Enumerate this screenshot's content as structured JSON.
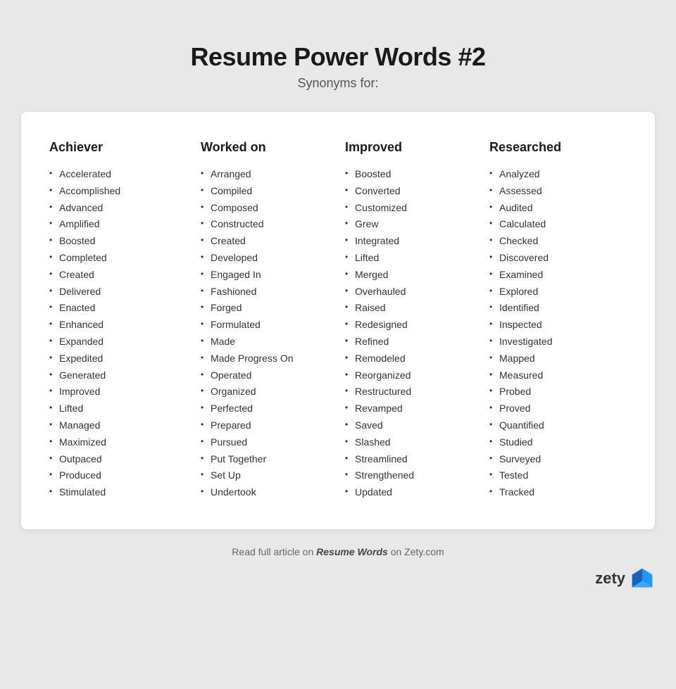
{
  "header": {
    "title": "Resume Power Words #2",
    "subtitle": "Synonyms for:"
  },
  "columns": [
    {
      "header": "Achiever",
      "words": [
        "Accelerated",
        "Accomplished",
        "Advanced",
        "Amplified",
        "Boosted",
        "Completed",
        "Created",
        "Delivered",
        "Enacted",
        "Enhanced",
        "Expanded",
        "Expedited",
        "Generated",
        "Improved",
        "Lifted",
        "Managed",
        "Maximized",
        "Outpaced",
        "Produced",
        "Stimulated"
      ]
    },
    {
      "header": "Worked on",
      "words": [
        "Arranged",
        "Compiled",
        "Composed",
        "Constructed",
        "Created",
        "Developed",
        "Engaged In",
        "Fashioned",
        "Forged",
        "Formulated",
        "Made",
        "Made Progress On",
        "Operated",
        "Organized",
        "Perfected",
        "Prepared",
        "Pursued",
        "Put Together",
        "Set Up",
        "Undertook"
      ]
    },
    {
      "header": "Improved",
      "words": [
        "Boosted",
        "Converted",
        "Customized",
        "Grew",
        "Integrated",
        "Lifted",
        "Merged",
        "Overhauled",
        "Raised",
        "Redesigned",
        "Refined",
        "Remodeled",
        "Reorganized",
        "Restructured",
        "Revamped",
        "Saved",
        "Slashed",
        "Streamlined",
        "Strengthened",
        "Updated"
      ]
    },
    {
      "header": "Researched",
      "words": [
        "Analyzed",
        "Assessed",
        "Audited",
        "Calculated",
        "Checked",
        "Discovered",
        "Examined",
        "Explored",
        "Identified",
        "Inspected",
        "Investigated",
        "Mapped",
        "Measured",
        "Probed",
        "Proved",
        "Quantified",
        "Studied",
        "Surveyed",
        "Tested",
        "Tracked"
      ]
    }
  ],
  "footer": {
    "prefix": "Read full article on ",
    "link_text": "Resume Words",
    "suffix": " on Zety.com"
  },
  "logo": {
    "text": "zety"
  }
}
